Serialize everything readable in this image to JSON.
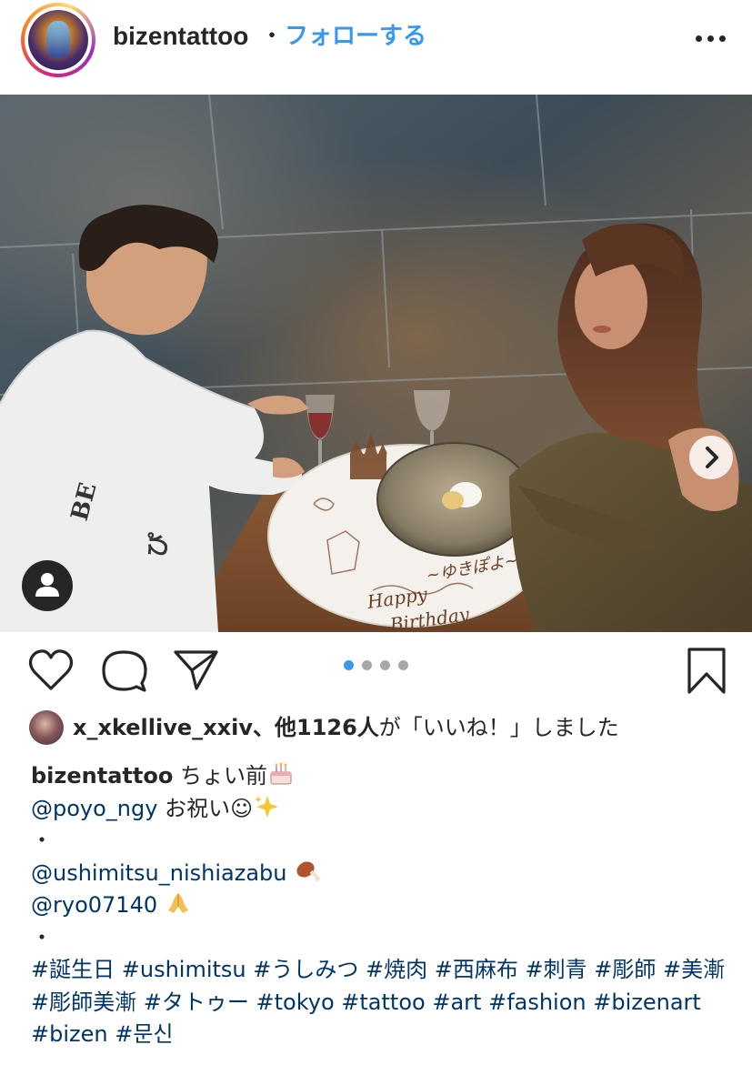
{
  "post": {
    "username": "bizentattoo",
    "separator": "・",
    "follow_label": "フォローする",
    "more_icon": "more-horizontal-icon"
  },
  "photo": {
    "description_icon": "photo",
    "next_icon": "chevron-right-icon",
    "tag_icon": "person-icon"
  },
  "actions": {
    "like_icon": "heart-icon",
    "comment_icon": "comment-bubble-icon",
    "share_icon": "paper-plane-icon",
    "save_icon": "bookmark-icon",
    "carousel_total": 4,
    "carousel_active": 1
  },
  "likes": {
    "liker": "x_xkellive_xxiv",
    "count_text": "、他1126人",
    "suffix": "が「いいね！」しました"
  },
  "caption": {
    "username": "bizentattoo",
    "text1": "ちょい前",
    "mention1": "@poyo_ngy",
    "text2": "お祝い☺",
    "bullet": "・",
    "mention2": "@ushimitsu_nishiazabu",
    "mention3": "@ryo07140",
    "hashtags": [
      "#誕生日",
      "#ushimitsu",
      "#うしみつ",
      "#焼肉",
      "#西麻布",
      "#刺青",
      "#彫師",
      "#美漸",
      "#彫師美漸",
      "#タトゥー",
      "#tokyo",
      "#tattoo",
      "#art",
      "#fashion",
      "#bizenart",
      "#bizen",
      "#문신"
    ]
  },
  "colors": {
    "text": "#262626",
    "link_blue": "#3897f0",
    "hashtag_blue": "#003569",
    "pager_inactive": "#a8a8a8"
  }
}
